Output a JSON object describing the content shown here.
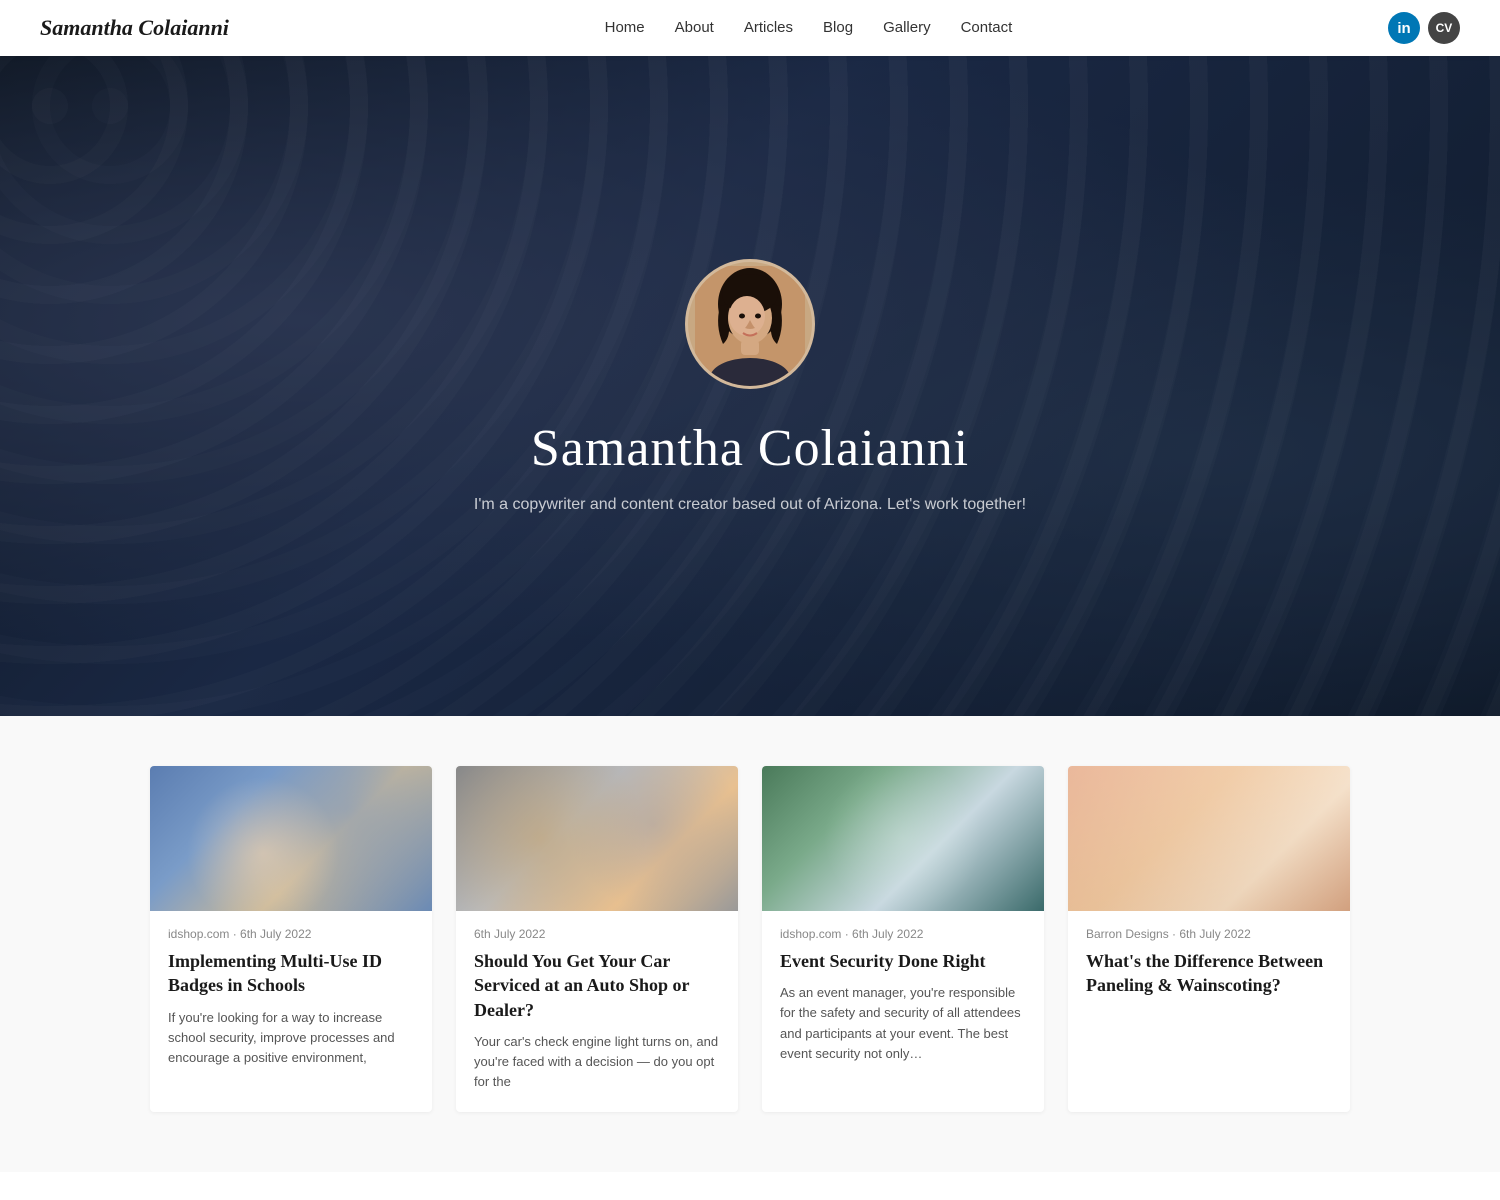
{
  "site": {
    "brand": "Samantha Colaianni"
  },
  "nav": {
    "links": [
      {
        "label": "Home",
        "href": "#"
      },
      {
        "label": "About",
        "href": "#"
      },
      {
        "label": "Articles",
        "href": "#"
      },
      {
        "label": "Blog",
        "href": "#"
      },
      {
        "label": "Gallery",
        "href": "#"
      },
      {
        "label": "Contact",
        "href": "#"
      }
    ],
    "linkedin_label": "in",
    "cv_label": "CV"
  },
  "hero": {
    "name": "Samantha Colaianni",
    "tagline": "I'm a copywriter and content creator based out of Arizona. Let's work together!"
  },
  "cards": [
    {
      "source": "idshop.com · 6th July 2022",
      "title": "Implementing Multi-Use ID Badges in Schools",
      "excerpt": "If you're looking for a way to increase school security, improve processes and encourage a positive environment,",
      "img_class": "card-img-1"
    },
    {
      "source": "6th July 2022",
      "title": "Should You Get Your Car Serviced at an Auto Shop or Dealer?",
      "excerpt": "Your car's check engine light turns on, and you're faced with a decision — do you opt for the",
      "img_class": "card-img-2"
    },
    {
      "source": "idshop.com · 6th July 2022",
      "title": "Event Security Done Right",
      "excerpt": "As an event manager, you're responsible for the safety and security of all attendees and participants at your event. The best event security not only…",
      "img_class": "card-img-3"
    },
    {
      "source": "Barron Designs · 6th July 2022",
      "title": "What's the Difference Between Paneling & Wainscoting?",
      "excerpt": "",
      "img_class": "card-img-4"
    }
  ]
}
